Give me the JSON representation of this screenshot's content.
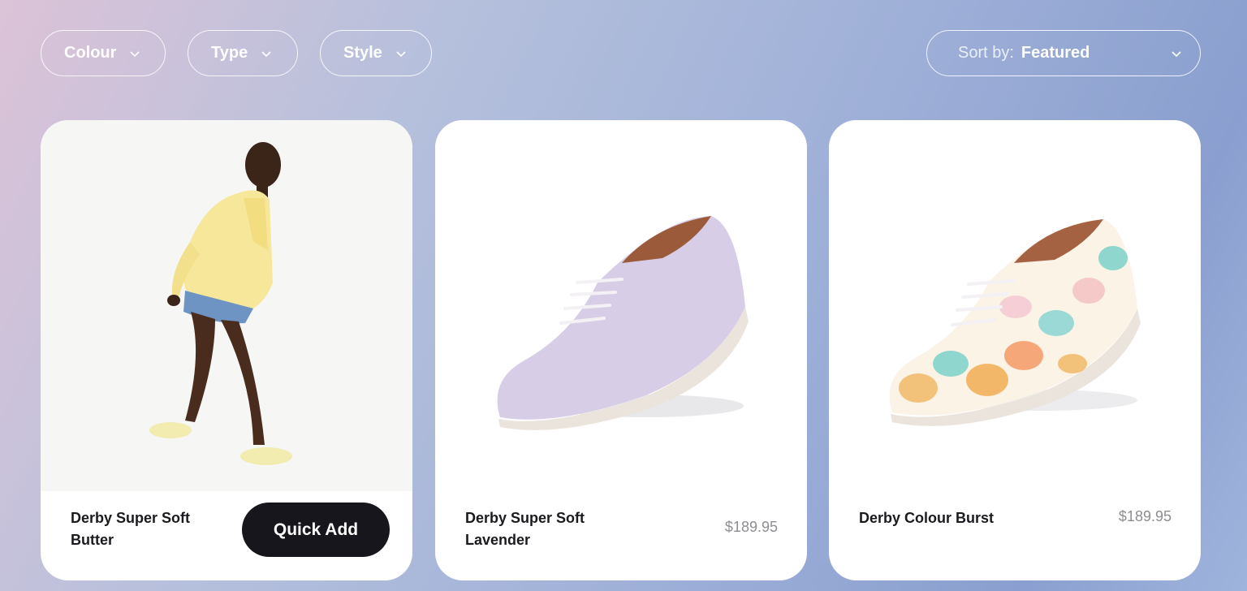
{
  "filters": {
    "colour_label": "Colour",
    "type_label": "Type",
    "style_label": "Style"
  },
  "sort": {
    "prefix": "Sort by:",
    "value": "Featured"
  },
  "products": [
    {
      "name": "Derby Super Soft Butter",
      "price": "",
      "action_label": "Quick Add",
      "image": "model-wearing-yellow-derby-shoes"
    },
    {
      "name": "Derby Super Soft Lavender",
      "price": "$189.95",
      "image": "lavender-derby-shoe"
    },
    {
      "name": "Derby Colour Burst",
      "price": "$189.95",
      "image": "watercolour-derby-shoe"
    }
  ],
  "colors": {
    "button_dark": "#16161c",
    "price_grey": "#8d8d92",
    "lavender": "#d8cde6",
    "butter": "#f6eea0"
  }
}
